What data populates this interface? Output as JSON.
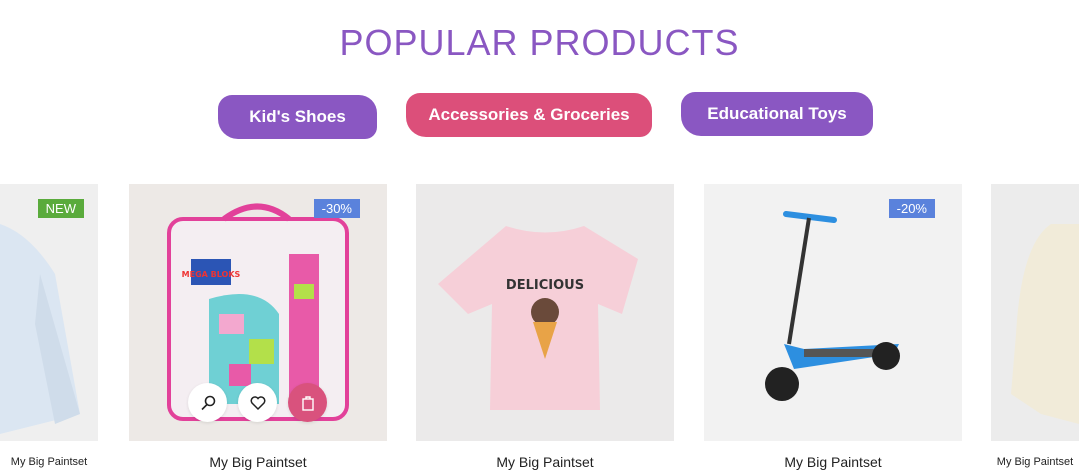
{
  "section_title": "POPULAR PRODUCTS",
  "tabs": [
    {
      "label": "Kid's Shoes",
      "color": "#8a57c2"
    },
    {
      "label": "Accessories & Groceries",
      "color": "#dc4f7a"
    },
    {
      "label": "Educational Toys",
      "color": "#8a57c2"
    }
  ],
  "products": [
    {
      "name": "My Big Paintset",
      "badge": "NEW",
      "badge_color": "#5aab3c"
    },
    {
      "name": "My Big Paintset",
      "badge": "-30%",
      "badge_color": "#5a82dc"
    },
    {
      "name": "My Big Paintset",
      "badge": null
    },
    {
      "name": "My Big Paintset",
      "badge": "-20%",
      "badge_color": "#5a82dc"
    },
    {
      "name": "My Big Paintset",
      "badge": null
    }
  ],
  "tshirt_text": "DELICIOUS",
  "box_logo": "MEGA BLOKS"
}
